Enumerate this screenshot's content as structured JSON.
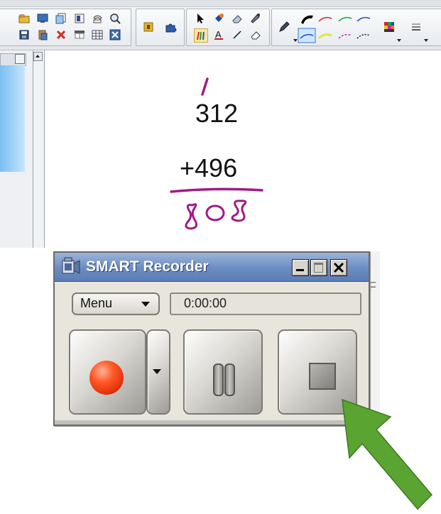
{
  "recorder": {
    "title": "SMART Recorder",
    "menu_label": "Menu",
    "timer": "0:00:00",
    "window_buttons": [
      "minimize",
      "maximize",
      "close"
    ],
    "accent_color": "#6b8cc2"
  },
  "canvas": {
    "carry_mark": "/",
    "top_number": "312",
    "second_number": "+496",
    "answer": "808",
    "ink_color": "#a01b86"
  },
  "behind": {
    "fragment": "F"
  },
  "icons": {
    "toolbar_group_1": [
      "open-file-icon",
      "screen-capture-icon",
      "copy-page-icon",
      "page-icon",
      "undo-icon",
      "search-icon",
      "save-icon",
      "paste-icon",
      "delete-icon",
      "screen-shade-icon",
      "table-icon",
      "fullscreen-icon"
    ],
    "toolbar_group_2": [
      "notebook-icon",
      "puzzle-icon"
    ],
    "toolbar_group_3": [
      "select-arrow-icon",
      "fill-icon",
      "eraser-icon",
      "magic-pen-icon",
      "pen-tool-icon",
      "text-icon",
      "line-icon",
      "shape-eraser-icon"
    ],
    "toolbar_group_4": [
      "pen-icon",
      "line-style-icon",
      "color-palette-icon",
      "line-width-icon"
    ]
  }
}
